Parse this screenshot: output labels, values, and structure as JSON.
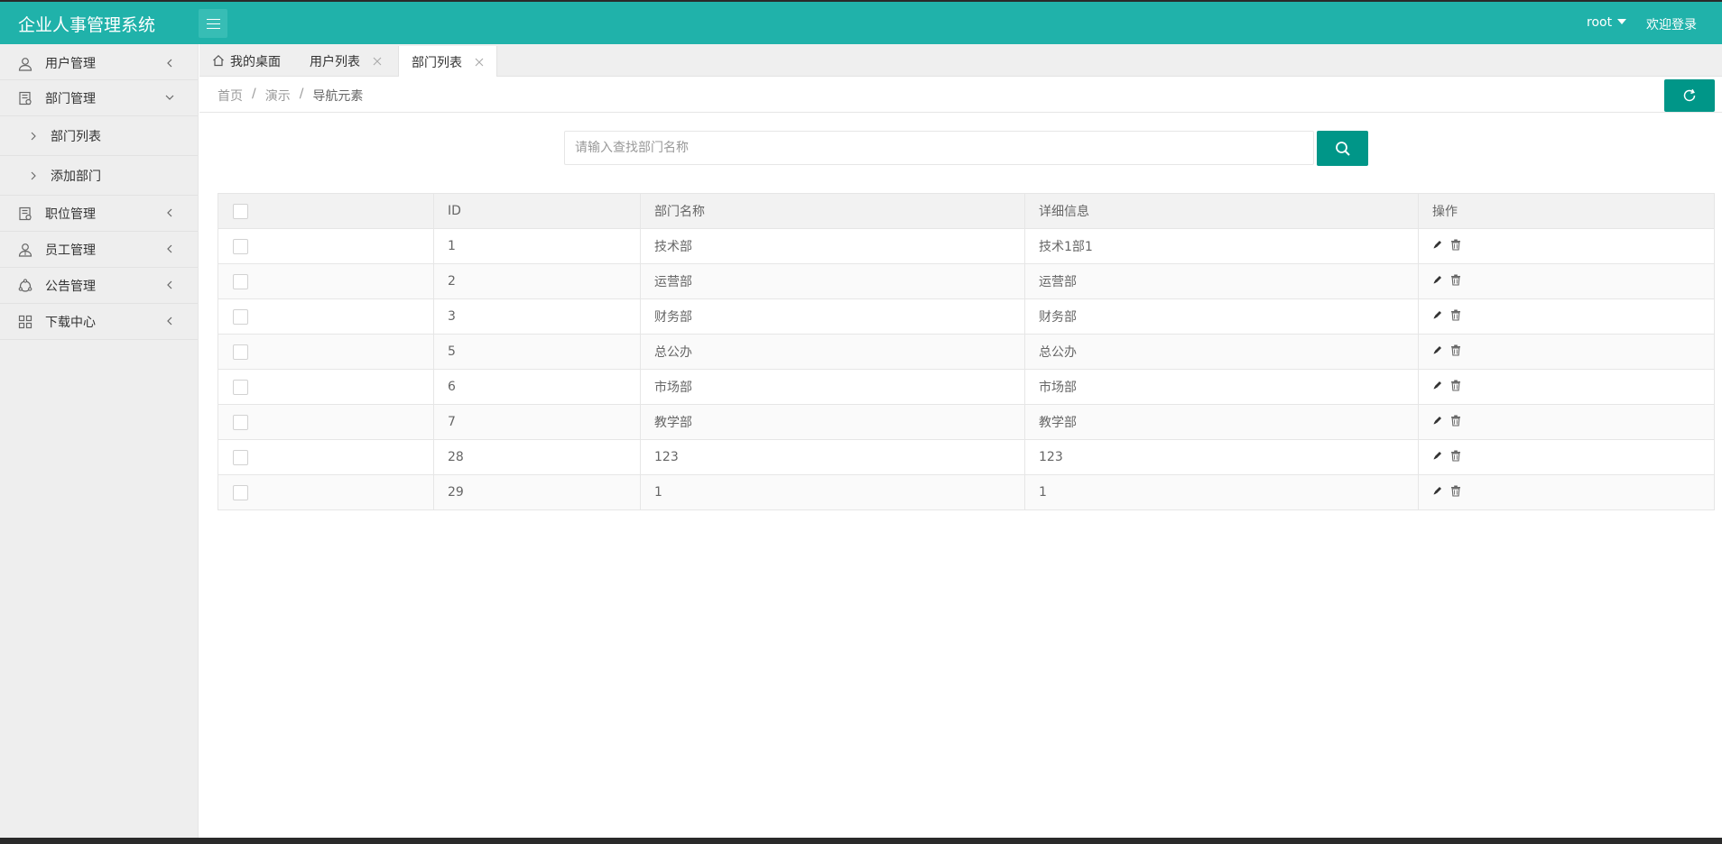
{
  "app": {
    "title": "企业人事管理系统"
  },
  "header": {
    "user": "root",
    "welcome": "欢迎登录"
  },
  "sidebar": {
    "items": [
      {
        "label": "用户管理",
        "icon": "user-icon",
        "expanded": false
      },
      {
        "label": "部门管理",
        "icon": "department-icon",
        "expanded": true,
        "children": [
          {
            "label": "部门列表"
          },
          {
            "label": "添加部门"
          }
        ]
      },
      {
        "label": "职位管理",
        "icon": "position-icon",
        "expanded": false
      },
      {
        "label": "员工管理",
        "icon": "employee-icon",
        "expanded": false
      },
      {
        "label": "公告管理",
        "icon": "notice-icon",
        "expanded": false
      },
      {
        "label": "下载中心",
        "icon": "download-icon",
        "expanded": false
      }
    ]
  },
  "tabs": [
    {
      "label": "我的桌面",
      "icon": "home-icon",
      "closable": false,
      "active": false
    },
    {
      "label": "用户列表",
      "closable": true,
      "active": false
    },
    {
      "label": "部门列表",
      "closable": true,
      "active": true
    }
  ],
  "breadcrumb": [
    "首页",
    "演示",
    "导航元素"
  ],
  "search": {
    "placeholder": "请输入查找部门名称",
    "value": ""
  },
  "table": {
    "columns": [
      "ID",
      "部门名称",
      "详细信息",
      "操作"
    ],
    "rows": [
      {
        "id": "1",
        "name": "技术部",
        "detail": "技术1部1"
      },
      {
        "id": "2",
        "name": "运营部",
        "detail": "运营部"
      },
      {
        "id": "3",
        "name": "财务部",
        "detail": "财务部"
      },
      {
        "id": "5",
        "name": "总公办",
        "detail": "总公办"
      },
      {
        "id": "6",
        "name": "市场部",
        "detail": "市场部"
      },
      {
        "id": "7",
        "name": "教学部",
        "detail": "教学部"
      },
      {
        "id": "28",
        "name": "123",
        "detail": "123"
      },
      {
        "id": "29",
        "name": "1",
        "detail": "1"
      }
    ]
  },
  "colors": {
    "header": "#20b2aa",
    "primary": "#009688",
    "sidebar": "#eeeeee"
  }
}
